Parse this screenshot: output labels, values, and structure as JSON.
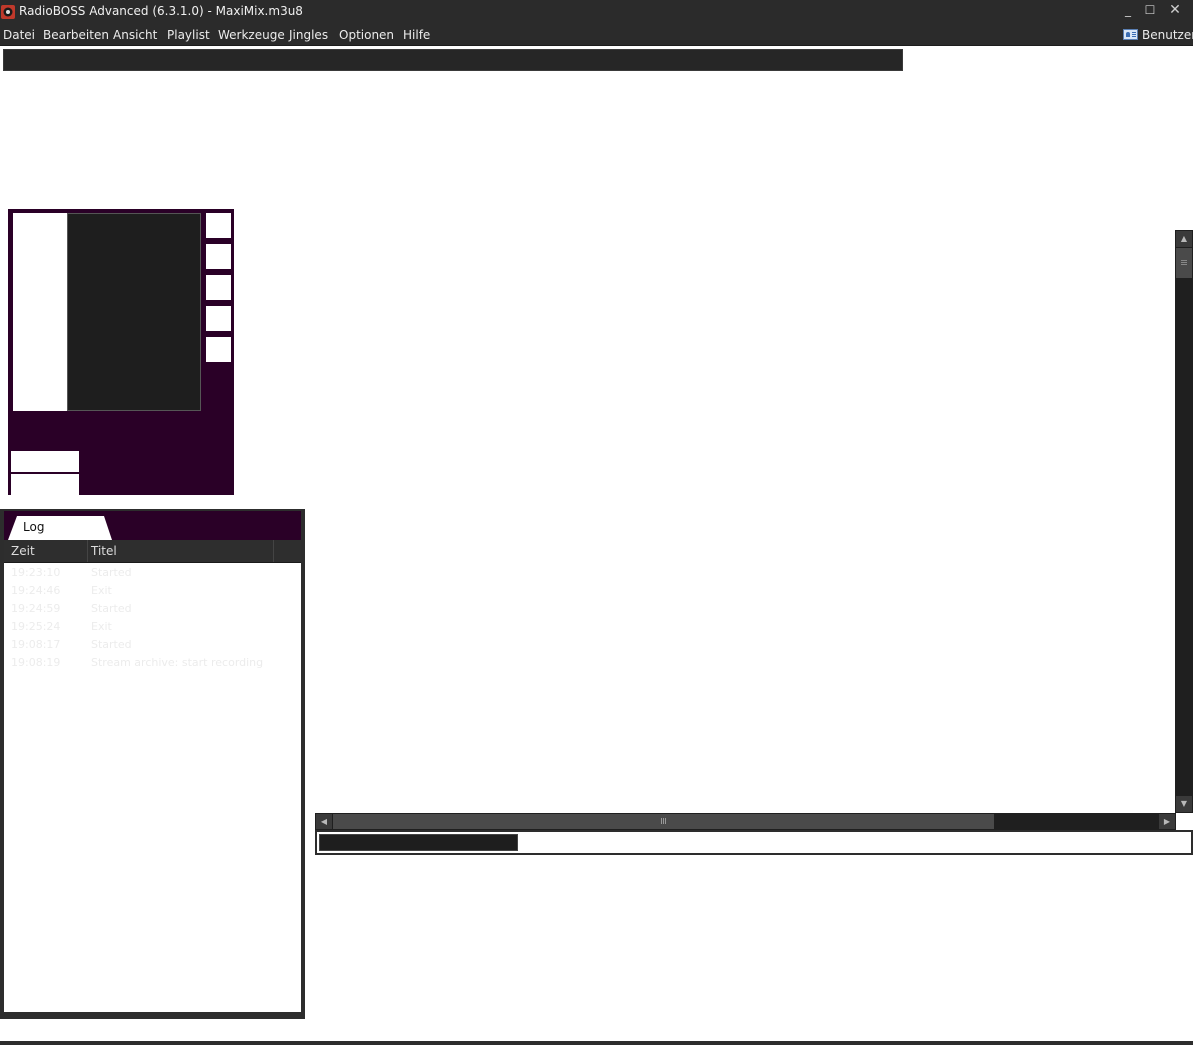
{
  "window": {
    "title": "RadioBOSS Advanced (6.3.1.0) - MaxiMix.m3u8",
    "icon": "radioboss-app-icon",
    "controls": {
      "minimize": "_",
      "maximize": "☐",
      "close": "✕"
    }
  },
  "menu": {
    "items": [
      "Datei",
      "Bearbeiten",
      "Ansicht",
      "Playlist",
      "Werkzeuge",
      "Jingles",
      "Optionen",
      "Hilfe"
    ],
    "user_label": "Benutzer"
  },
  "log": {
    "tab_label": "Log",
    "columns": [
      "Zeit",
      "Titel"
    ],
    "rows": [
      {
        "time": "19:23:10",
        "title": "Started"
      },
      {
        "time": "19:24:46",
        "title": "Exit"
      },
      {
        "time": "19:24:59",
        "title": "Started"
      },
      {
        "time": "19:25:24",
        "title": "Exit"
      },
      {
        "time": "19:08:17",
        "title": "Started"
      },
      {
        "time": "19:08:19",
        "title": "Stream archive: start recording"
      }
    ]
  },
  "colors": {
    "chrome": "#2b2b2b",
    "panel_purple": "#2a0027",
    "display_dark": "#1e1e1e"
  }
}
